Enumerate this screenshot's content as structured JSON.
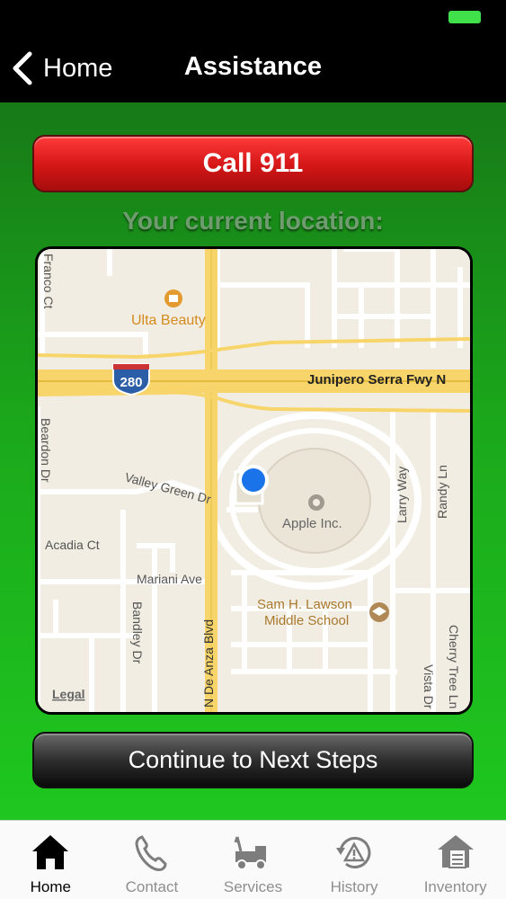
{
  "nav": {
    "back_label": "Home",
    "title": "Assistance"
  },
  "actions": {
    "call_label": "Call 911",
    "location_label": "Your current location:",
    "continue_label": "Continue to Next Steps"
  },
  "map": {
    "labels": {
      "franco": "Franco Ct",
      "ulta": "Ulta Beauty",
      "highway_shield": "280",
      "junipero": "Junipero Serra Fwy N",
      "beardon": "Beardon Dr",
      "valley_green": "Valley Green Dr",
      "acadia": "Acadia Ct",
      "mariani": "Mariani Ave",
      "bandley": "Bandley Dr",
      "de_anza": "N De Anza Blvd",
      "apple": "Apple Inc.",
      "larry": "Larry Way",
      "randy": "Randy Ln",
      "school_line1": "Sam H. Lawson",
      "school_line2": "Middle School",
      "vista": "Vista Dr",
      "cherry": "Cherry Tree Ln",
      "legal": "Legal"
    },
    "colors": {
      "land": "#f2ede2",
      "road": "#ffffff",
      "highway": "#f7d56a",
      "poi_orange": "#e39a2e",
      "location_dot": "#1a73e8"
    }
  },
  "tabs": [
    {
      "label": "Home",
      "icon": "home-icon",
      "active": true
    },
    {
      "label": "Contact",
      "icon": "phone-icon",
      "active": false
    },
    {
      "label": "Services",
      "icon": "tow-truck-icon",
      "active": false
    },
    {
      "label": "History",
      "icon": "history-warning-icon",
      "active": false
    },
    {
      "label": "Inventory",
      "icon": "inventory-house-icon",
      "active": false
    }
  ]
}
